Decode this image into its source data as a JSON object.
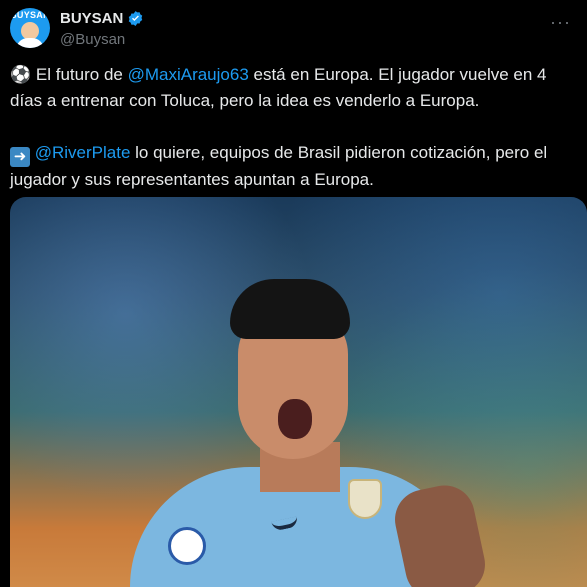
{
  "header": {
    "avatar_label": "BUYSAN",
    "display_name": "BUYSAN",
    "handle": "@Buysan"
  },
  "tweet": {
    "line1_pre": "El futuro de ",
    "line1_mention": "@MaxiAraujo63",
    "line1_post": " está en Europa. El jugador vuelve en 4 días a entrenar con Toluca, pero la idea es venderlo a Europa.",
    "line2_mention": "@RiverPlate",
    "line2_post": " lo quiere, equipos de Brasil pidieron cotización, pero el jugador y sus representantes apuntan a Europa."
  },
  "icons": {
    "lead_emoji": "soccer-ball-icon",
    "arrow": "right-arrow-icon",
    "verified": "verified-badge-icon",
    "more": "more-options-icon"
  },
  "colors": {
    "background": "#000000",
    "text": "#e7e9ea",
    "secondary": "#71767b",
    "accent": "#1d9bf0"
  }
}
